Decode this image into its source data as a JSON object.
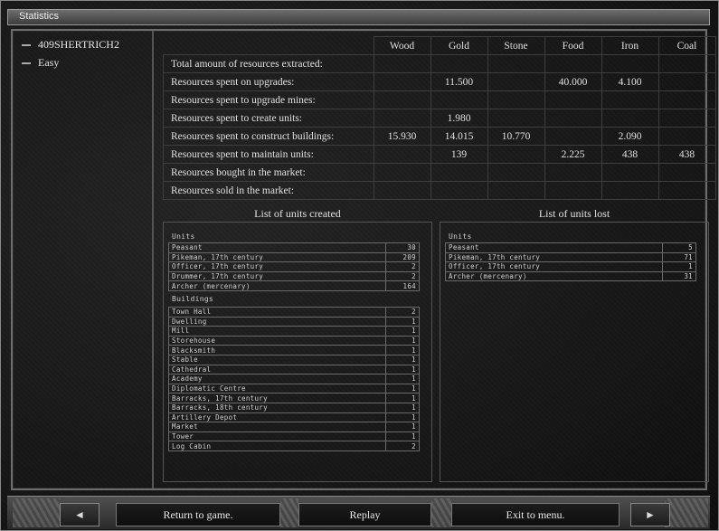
{
  "window": {
    "title": "Statistics"
  },
  "players": [
    {
      "name": "409SHERTRICH2"
    },
    {
      "name": "Easy"
    }
  ],
  "resources": {
    "columns": [
      "Wood",
      "Gold",
      "Stone",
      "Food",
      "Iron",
      "Coal"
    ],
    "rows": [
      {
        "label": "Total amount of resources extracted:",
        "values": [
          "",
          "",
          "",
          "",
          "",
          ""
        ]
      },
      {
        "label": "Resources spent on upgrades:",
        "values": [
          "",
          "11.500",
          "",
          "40.000",
          "4.100",
          ""
        ]
      },
      {
        "label": "Resources spent to upgrade mines:",
        "values": [
          "",
          "",
          "",
          "",
          "",
          ""
        ]
      },
      {
        "label": "Resources spent to create units:",
        "values": [
          "",
          "1.980",
          "",
          "",
          "",
          ""
        ]
      },
      {
        "label": "Resources spent to construct buildings:",
        "values": [
          "15.930",
          "14.015",
          "10.770",
          "",
          "2.090",
          ""
        ]
      },
      {
        "label": "Resources spent to maintain units:",
        "values": [
          "",
          "139",
          "",
          "2.225",
          "438",
          "438"
        ]
      },
      {
        "label": "Resources bought in the market:",
        "values": [
          "",
          "",
          "",
          "",
          "",
          ""
        ]
      },
      {
        "label": "Resources sold in the market:",
        "values": [
          "",
          "",
          "",
          "",
          "",
          ""
        ]
      }
    ]
  },
  "created": {
    "title": "List of units created",
    "units_label": "Units",
    "units": [
      {
        "name": "Peasant",
        "count": "30"
      },
      {
        "name": "Pikeman, 17th century",
        "count": "209"
      },
      {
        "name": "Officer, 17th century",
        "count": "2"
      },
      {
        "name": "Drummer, 17th century",
        "count": "2"
      },
      {
        "name": "Archer (mercenary)",
        "count": "164"
      }
    ],
    "buildings_label": "Buildings",
    "buildings": [
      {
        "name": "Town Hall",
        "count": "2"
      },
      {
        "name": "Dwelling",
        "count": "1"
      },
      {
        "name": "Mill",
        "count": "1"
      },
      {
        "name": "Storehouse",
        "count": "1"
      },
      {
        "name": "Blacksmith",
        "count": "1"
      },
      {
        "name": "Stable",
        "count": "1"
      },
      {
        "name": "Cathedral",
        "count": "1"
      },
      {
        "name": "Academy",
        "count": "1"
      },
      {
        "name": "Diplomatic Centre",
        "count": "1"
      },
      {
        "name": "Barracks, 17th century",
        "count": "1"
      },
      {
        "name": "Barracks, 18th century",
        "count": "1"
      },
      {
        "name": "Artillery Depot",
        "count": "1"
      },
      {
        "name": "Market",
        "count": "1"
      },
      {
        "name": "Tower",
        "count": "1"
      },
      {
        "name": "Log Cabin",
        "count": "2"
      }
    ]
  },
  "lost": {
    "title": "List of units lost",
    "units_label": "Units",
    "units": [
      {
        "name": "Peasant",
        "count": "5"
      },
      {
        "name": "Pikeman, 17th century",
        "count": "71"
      },
      {
        "name": "Officer, 17th century",
        "count": "1"
      },
      {
        "name": "Archer (mercenary)",
        "count": "31"
      }
    ]
  },
  "buttons": {
    "return": "Return to game.",
    "replay": "Replay",
    "exit": "Exit to menu.",
    "prev_icon": "◄",
    "next_icon": "►"
  }
}
